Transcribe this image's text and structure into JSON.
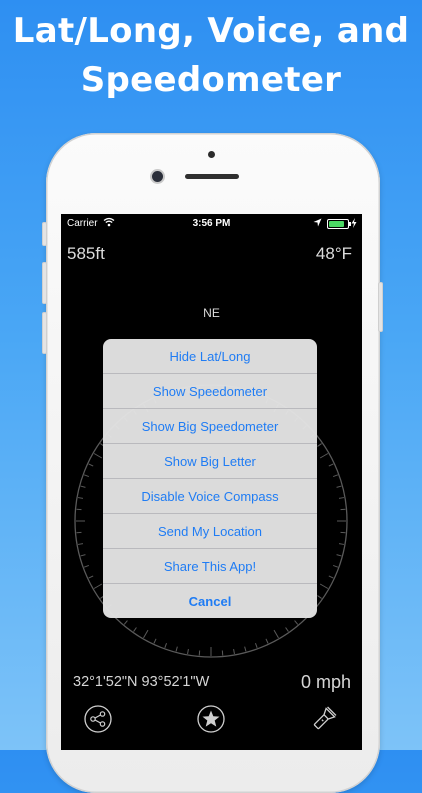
{
  "headline": {
    "line1": "Lat/Long, Voice, and",
    "line2": "Speedometer"
  },
  "status_bar": {
    "carrier": "Carrier",
    "time": "3:56 PM"
  },
  "display": {
    "altitude": "585ft",
    "temperature": "48°F",
    "heading": "NE",
    "coordinates": "32°1'52\"N 93°52'1\"W",
    "speed": "0 mph"
  },
  "action_sheet": {
    "items": [
      {
        "label": "Hide Lat/Long"
      },
      {
        "label": "Show Speedometer"
      },
      {
        "label": "Show Big Speedometer"
      },
      {
        "label": "Show Big Letter"
      },
      {
        "label": "Disable Voice Compass"
      },
      {
        "label": "Send My Location"
      },
      {
        "label": "Share This App!"
      }
    ],
    "cancel_label": "Cancel"
  },
  "toolbar": {
    "icons": [
      "share-icon",
      "star-icon",
      "flashlight-icon"
    ]
  },
  "colors": {
    "background_top": "#2e8ff2",
    "background_bottom": "#7dc3f8",
    "action_text": "#1f7cf4",
    "battery": "#4cd964"
  }
}
